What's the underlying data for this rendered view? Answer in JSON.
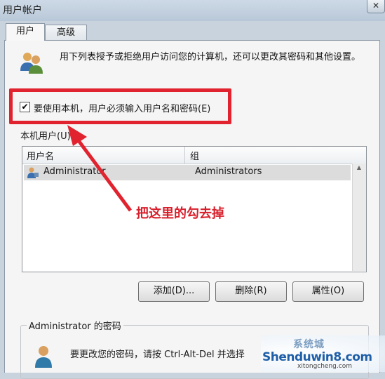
{
  "window": {
    "title": "用户帐户",
    "close_label": "✕"
  },
  "tabs": [
    {
      "label": "用户",
      "active": true
    },
    {
      "label": "高级",
      "active": false
    }
  ],
  "intro": {
    "text": "用下列表授予或拒绝用户访问您的计算机，还可以更改其密码和其他设置。"
  },
  "require_login": {
    "checked": true,
    "label": "要使用本机，用户必须输入用户名和密码(E)"
  },
  "local_users": {
    "label": "本机用户(U):",
    "columns": [
      "用户名",
      "组"
    ],
    "rows": [
      {
        "name": "Administrator",
        "group": "Administrators"
      }
    ]
  },
  "buttons": {
    "add": "添加(D)...",
    "remove": "删除(R)",
    "properties": "属性(O)"
  },
  "password_group": {
    "title": "Administrator 的密码",
    "text": "要更改您的密码，请按 Ctrl-Alt-Del 并选择"
  },
  "annotation": {
    "text": "把这里的勾去掉",
    "color": "#d8202c"
  },
  "watermark": {
    "logo": "系统城",
    "main": "Shenduwin8.com",
    "sub": "xitongcheng.com"
  }
}
